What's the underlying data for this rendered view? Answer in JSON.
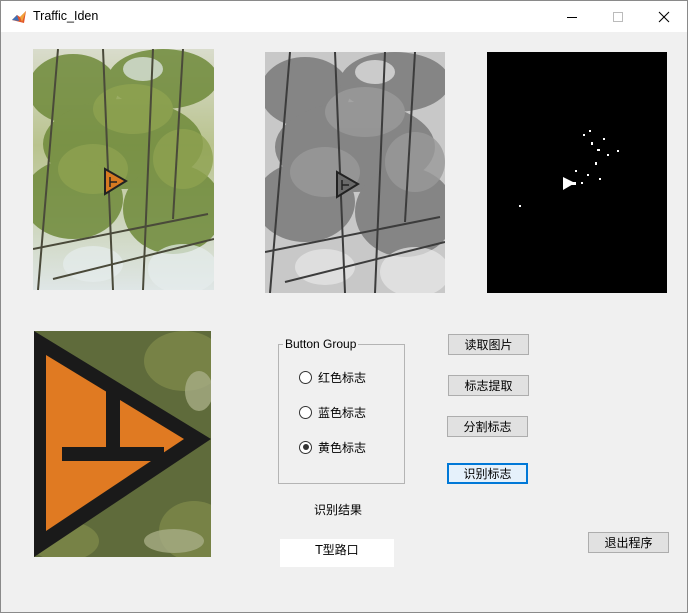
{
  "window": {
    "title": "Traffic_Iden"
  },
  "panels": {
    "original_image": "original-photo",
    "gray_image": "grayscale-photo",
    "binary_image": "binary-mask",
    "extracted_sign": "extracted-sign"
  },
  "button_group": {
    "title": "Button Group",
    "options": [
      {
        "label": "红色标志",
        "checked": false
      },
      {
        "label": "蓝色标志",
        "checked": false
      },
      {
        "label": "黄色标志",
        "checked": true
      }
    ]
  },
  "buttons": {
    "read_image": "读取图片",
    "extract_sign": "标志提取",
    "segment_sign": "分割标志",
    "recognize_sign": "识别标志",
    "exit_program": "退出程序"
  },
  "result": {
    "label": "识别结果",
    "value": "T型路口"
  },
  "colors": {
    "window_bg": "#f0f0f0",
    "sign_orange": "#e07a22",
    "sign_black": "#1a1a1a",
    "focus_blue": "#0078d7"
  }
}
